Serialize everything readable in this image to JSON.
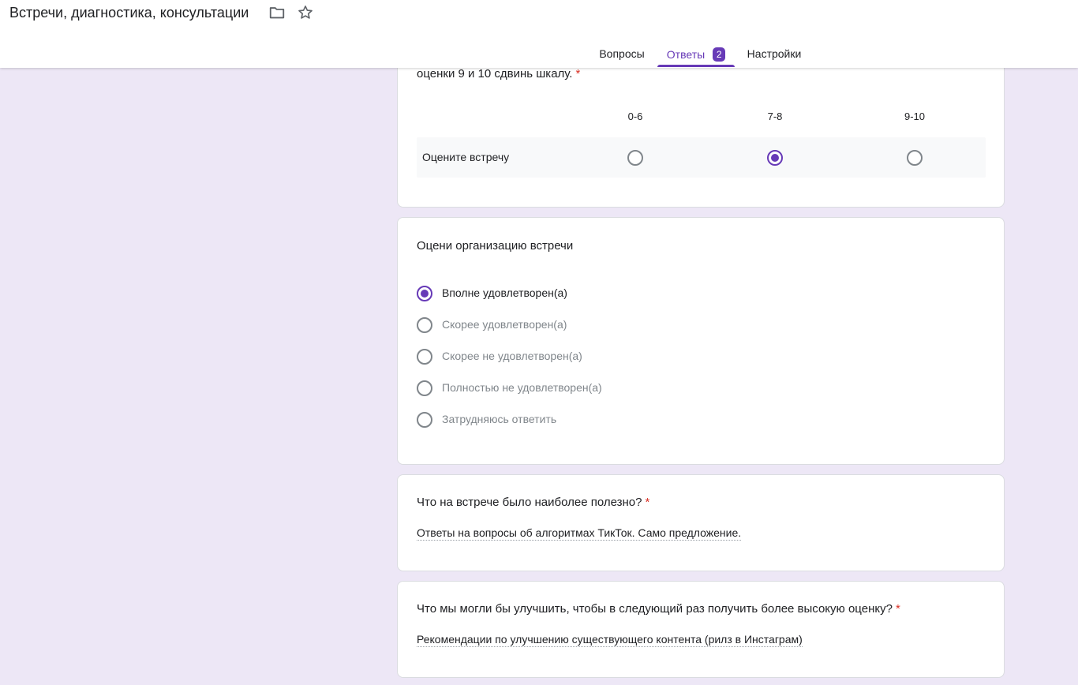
{
  "header": {
    "doc_title": "Встречи, диагностика, консультации",
    "folder_icon": "folder-icon",
    "star_icon": "star-icon"
  },
  "tabs": [
    {
      "label": "Вопросы",
      "active": false
    },
    {
      "label": "Ответы",
      "active": true,
      "badge": "2"
    },
    {
      "label": "Настройки",
      "active": false
    }
  ],
  "colors": {
    "accent": "#673ab7",
    "background": "#ede7f6",
    "required": "#d93025"
  },
  "q_grid": {
    "title": "оценки 9 и 10 сдвинь шкалу.",
    "required_mark": "*",
    "columns": [
      "0-6",
      "7-8",
      "9-10"
    ],
    "row_label": "Оцените встречу",
    "selected": "7-8"
  },
  "q_organization": {
    "title": "Оцени организацию встречи",
    "options": [
      {
        "label": "Вполне удовлетворен(а)",
        "selected": true
      },
      {
        "label": "Скорее удовлетворен(а)",
        "selected": false
      },
      {
        "label": "Скорее не удовлетворен(а)",
        "selected": false
      },
      {
        "label": "Полностью не удовлетворен(а)",
        "selected": false
      },
      {
        "label": "Затрудняюсь ответить",
        "selected": false
      }
    ]
  },
  "q_useful": {
    "title": "Что на встрече было наиболее полезно?",
    "required_mark": "*",
    "answer": "Ответы на вопросы об алгоритмах ТикТок. Само предложение."
  },
  "q_improve": {
    "title": "Что мы могли бы улучшить, чтобы в следующий раз получить более высокую оценку?",
    "required_mark": "*",
    "answer": "Рекомендации по улучшению существующего контента (рилз в Инстаграм)"
  }
}
